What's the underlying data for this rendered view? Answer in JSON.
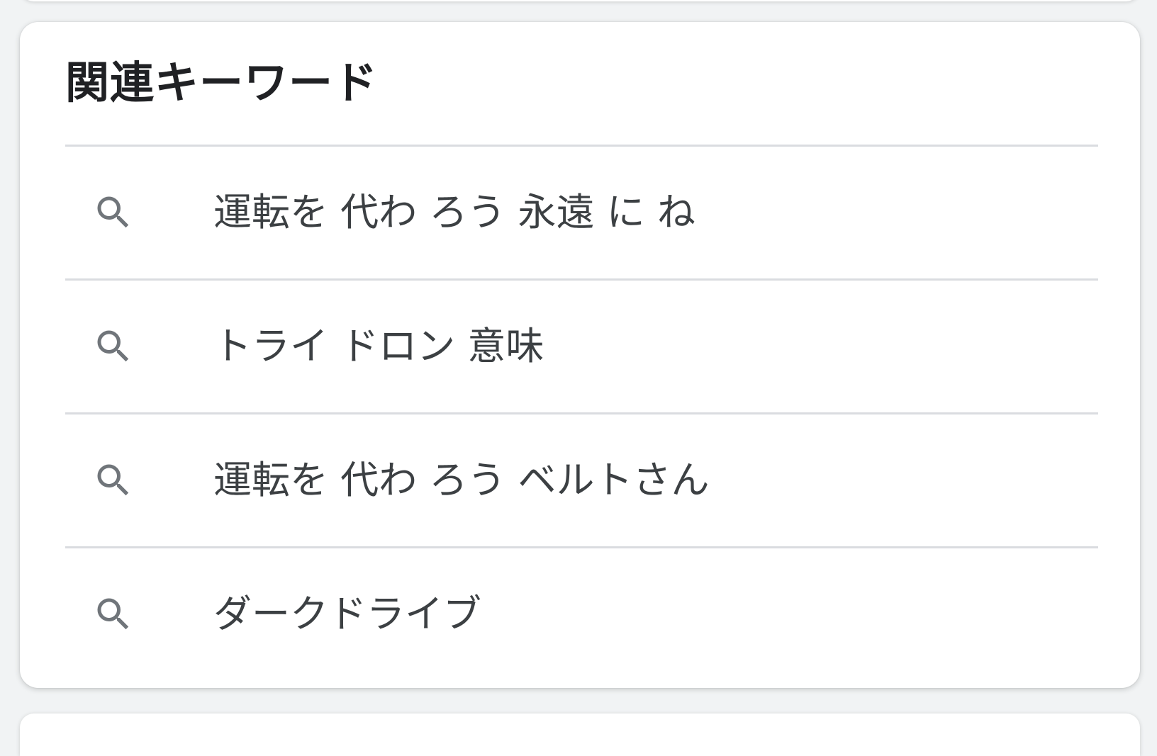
{
  "related": {
    "title": "関連キーワード",
    "items": [
      {
        "label": "運転を 代わ ろう 永遠 に ね",
        "icon": "search-icon"
      },
      {
        "label": "トライ ドロン 意味",
        "icon": "search-icon"
      },
      {
        "label": "運転を 代わ ろう ベルトさん",
        "icon": "search-icon"
      },
      {
        "label": "ダークドライブ",
        "icon": "search-icon"
      }
    ]
  },
  "colors": {
    "card_background": "#ffffff",
    "page_background": "#f1f3f4",
    "divider": "#dadce0",
    "icon": "#70757a",
    "title_text": "#202124",
    "item_text": "#3c4043"
  }
}
